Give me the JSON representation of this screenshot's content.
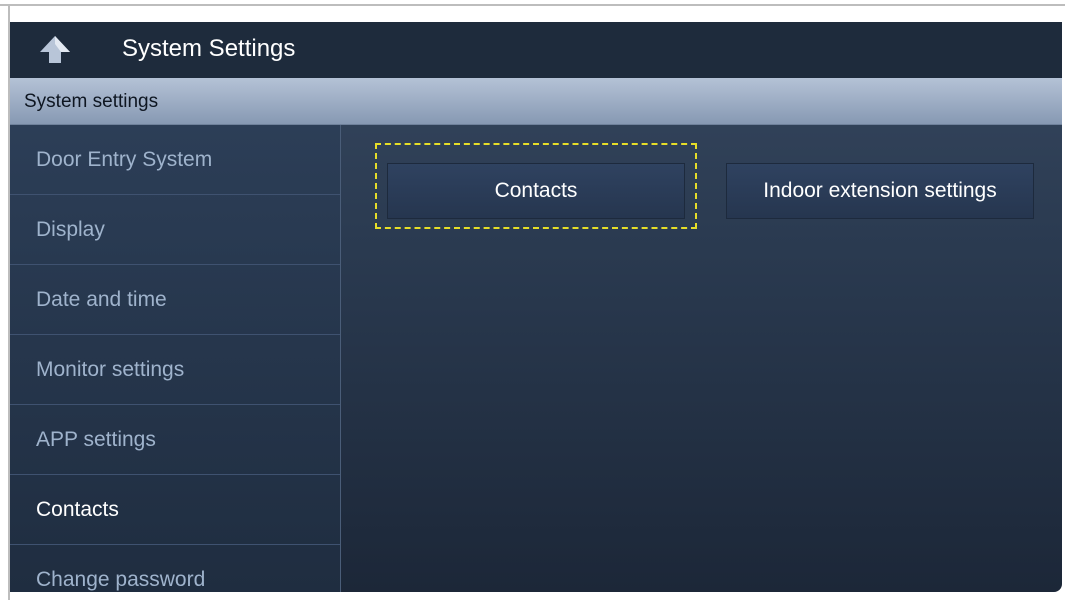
{
  "header": {
    "title": "System Settings",
    "back_icon": "up-arrow-icon"
  },
  "section": {
    "label": "System settings"
  },
  "sidebar": {
    "items": [
      {
        "label": "Door Entry System",
        "active": false
      },
      {
        "label": "Display",
        "active": false
      },
      {
        "label": "Date and time",
        "active": false
      },
      {
        "label": "Monitor settings",
        "active": false
      },
      {
        "label": "APP settings",
        "active": false
      },
      {
        "label": "Contacts",
        "active": true
      },
      {
        "label": "Change password",
        "active": false
      }
    ]
  },
  "main": {
    "tiles": [
      {
        "label": "Contacts",
        "focused": true
      },
      {
        "label": "Indoor extension settings",
        "focused": false
      }
    ]
  },
  "colors": {
    "focus_ring": "#e6de28",
    "titlebar": "#1e2b3c",
    "section_bar": "#9aabc3",
    "sidebar_text": "#9fb3cc",
    "active_text": "#ffffff"
  }
}
